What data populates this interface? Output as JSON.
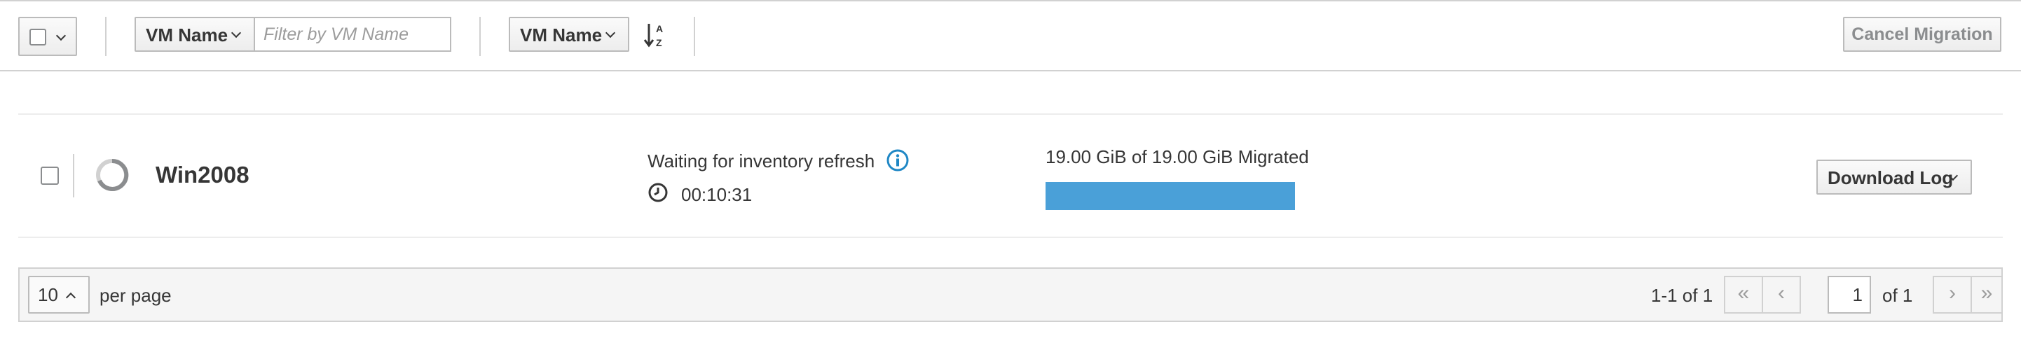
{
  "toolbar": {
    "filter_field_label": "VM Name",
    "filter_placeholder": "Filter by VM Name",
    "sort_field_label": "VM Name",
    "sort_icon": "sort-alpha-asc-icon",
    "cancel_label": "Cancel Migration"
  },
  "row": {
    "vm_name": "Win2008",
    "status_text": "Waiting for inventory refresh",
    "elapsed": "00:10:31",
    "migrated_text": "19.00 GiB of 19.00 GiB Migrated",
    "progress_percent": 100,
    "download_label": "Download Log"
  },
  "pagination": {
    "per_page_value": "10",
    "per_page_label": "per page",
    "range_text": "1-1 of 1",
    "current_page": "1",
    "of_total": "of 1"
  },
  "colors": {
    "progress": "#4aa0d8",
    "info": "#1f87c5",
    "border": "#bbbbbb"
  }
}
